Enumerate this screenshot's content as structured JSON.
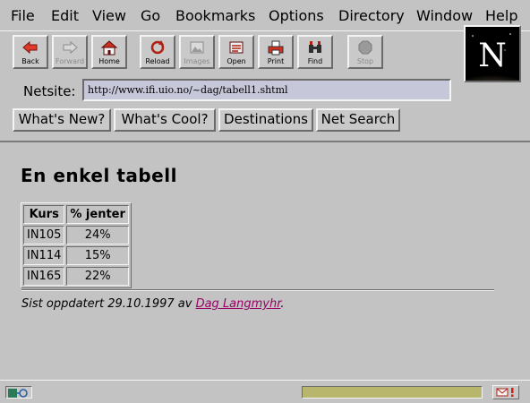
{
  "menu": [
    "File",
    "Edit",
    "View",
    "Go",
    "Bookmarks",
    "Options",
    "Directory",
    "Window",
    "Help"
  ],
  "toolbar": {
    "buttons": [
      {
        "label": "Back",
        "icon": "back-arrow-icon",
        "enabled": true
      },
      {
        "label": "Forward",
        "icon": "forward-arrow-icon",
        "enabled": false
      },
      {
        "label": "Home",
        "icon": "home-icon",
        "enabled": true
      },
      {
        "label": "Reload",
        "icon": "reload-icon",
        "enabled": true
      },
      {
        "label": "Images",
        "icon": "images-icon",
        "enabled": false
      },
      {
        "label": "Open",
        "icon": "open-icon",
        "enabled": true
      },
      {
        "label": "Print",
        "icon": "print-icon",
        "enabled": true
      },
      {
        "label": "Find",
        "icon": "find-icon",
        "enabled": true
      },
      {
        "label": "Stop",
        "icon": "stop-icon",
        "enabled": false
      }
    ]
  },
  "logo": {
    "letter": "N"
  },
  "location": {
    "label": "Netsite:",
    "url": "http://www.ifi.uio.no/~dag/tabell1.shtml"
  },
  "directory_buttons": [
    "What's New?",
    "What's Cool?",
    "Destinations",
    "Net Search"
  ],
  "page": {
    "heading": "En enkel tabell",
    "table": {
      "headers": [
        "Kurs",
        "% jenter"
      ],
      "rows": [
        [
          "IN105",
          "24%"
        ],
        [
          "IN114",
          "15%"
        ],
        [
          "IN165",
          "22%"
        ]
      ]
    },
    "updated_prefix": "Sist oppdatert 29.10.1997 av ",
    "author_link": "Dag Langmyhr",
    "updated_suffix": "."
  },
  "status": {
    "progress_fraction": 1.0,
    "progress_color": "#b7b66c"
  },
  "colors": {
    "background": "#c3c3c3",
    "url_field": "#c7c7da",
    "link": "#990066"
  }
}
